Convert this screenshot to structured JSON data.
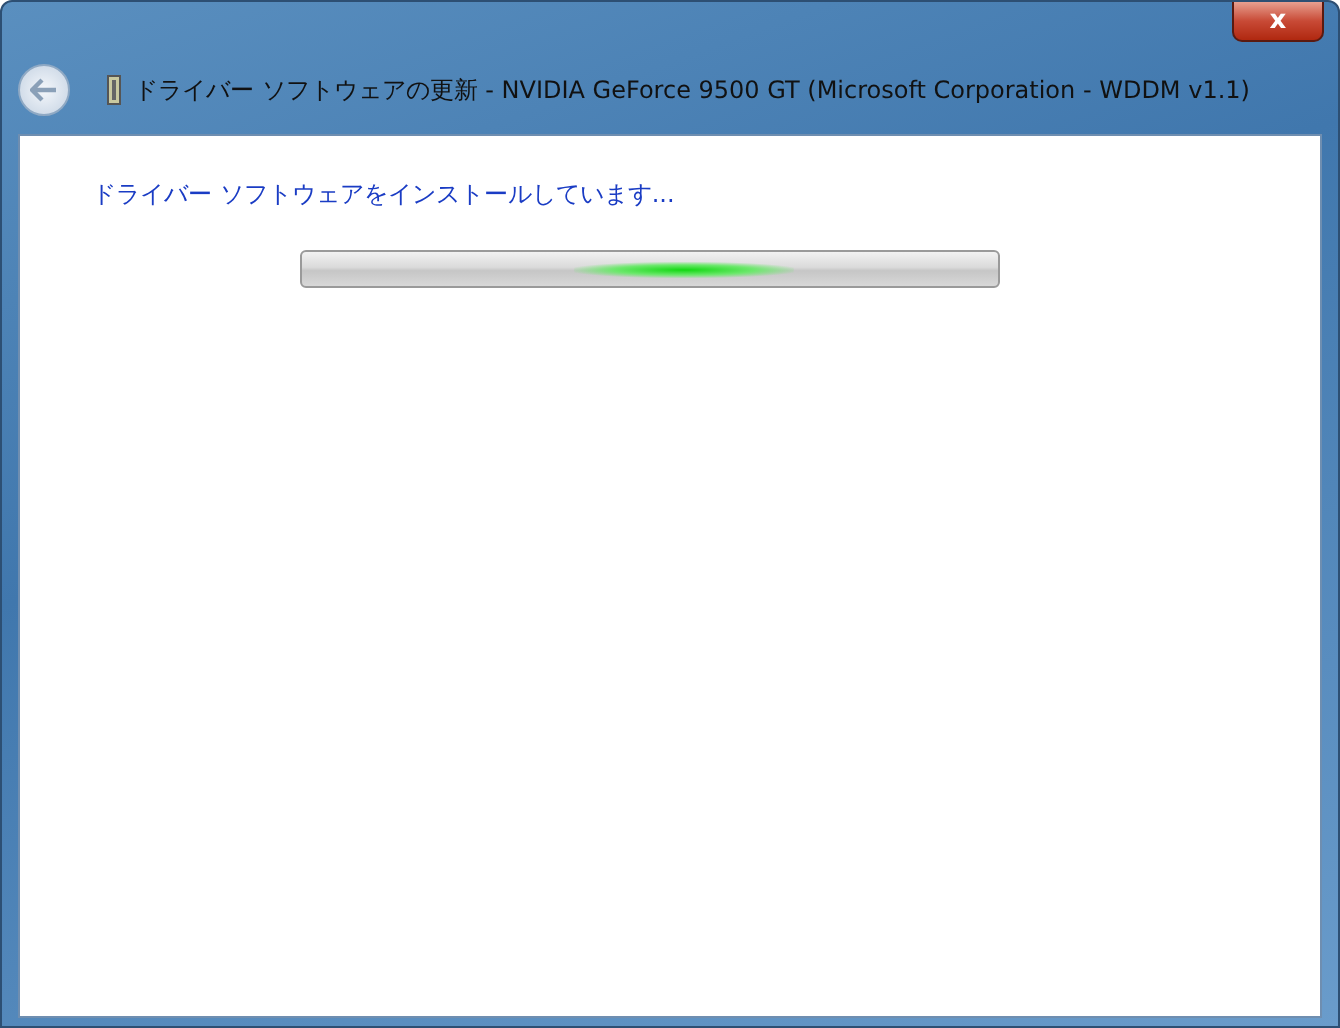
{
  "window": {
    "title": "ドライバー ソフトウェアの更新 - NVIDIA GeForce 9500 GT (Microsoft Corporation - WDDM v1.1)",
    "close": "x"
  },
  "content": {
    "status": "ドライバー ソフトウェアをインストールしています...",
    "progress": {
      "kind": "marquee",
      "level": 0.55
    }
  }
}
